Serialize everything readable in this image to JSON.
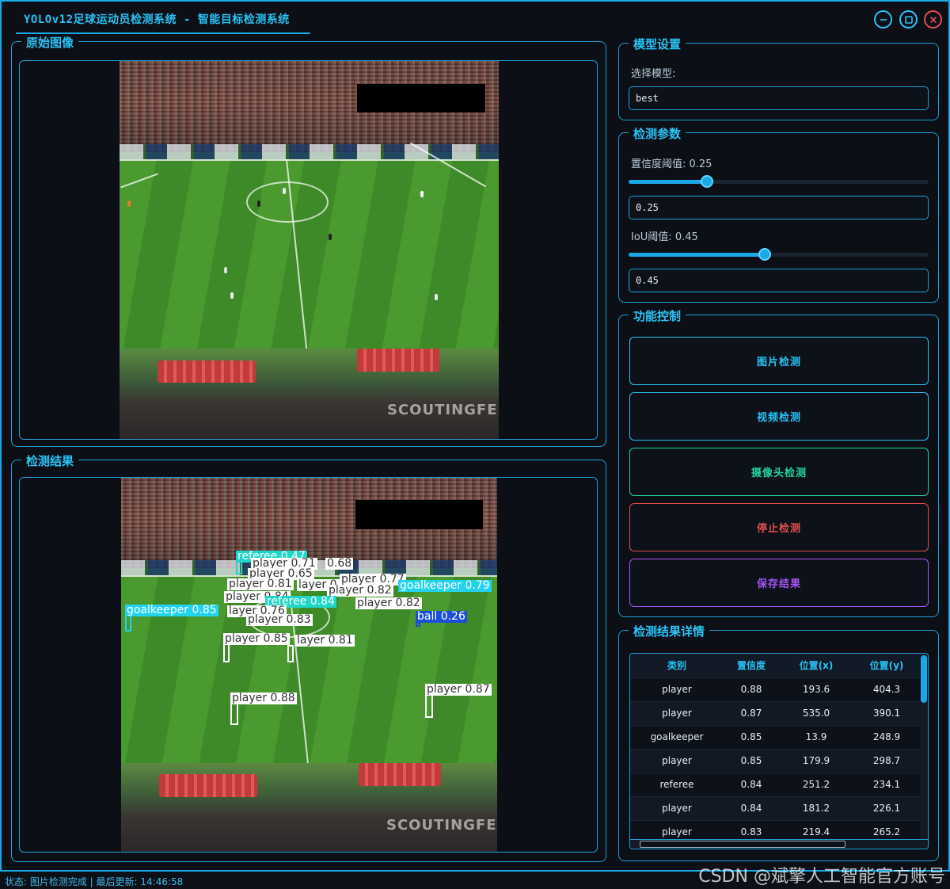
{
  "window": {
    "title": "YOLOv12足球运动员检测系统 - 智能目标检测系统"
  },
  "panels": {
    "original_title": "原始图像",
    "result_title": "检测结果",
    "model_title": "模型设置",
    "params_title": "检测参数",
    "control_title": "功能控制",
    "details_title": "检测结果详情"
  },
  "model": {
    "select_label": "选择模型:",
    "selected": "best"
  },
  "params": {
    "conf_label": "置信度阈值: 0.25",
    "conf_value": "0.25",
    "conf_level": 0.25,
    "iou_label": "IoU阈值: 0.45",
    "iou_value": "0.45",
    "iou_level": 0.45
  },
  "buttons": {
    "image_detect": "图片检测",
    "video_detect": "视频检测",
    "camera_detect": "摄像头检测",
    "stop_detect": "停止检测",
    "save_result": "保存结果"
  },
  "image": {
    "watermark": "SCOUTINGFEED"
  },
  "detections_overlay": [
    {
      "text": "referee 0.47",
      "color": "#1fd6c8"
    },
    {
      "text": "player 0.71",
      "color": "#ffffff"
    },
    {
      "text": "0.68",
      "color": "#ffffff"
    },
    {
      "text": "player 0.65",
      "color": "#ffffff"
    },
    {
      "text": "player 0.77",
      "color": "#ffffff"
    },
    {
      "text": "player 0.81",
      "color": "#ffffff"
    },
    {
      "text": "layer 0.",
      "color": "#ffffff"
    },
    {
      "text": "player 0.82",
      "color": "#ffffff"
    },
    {
      "text": "goalkeeper 0.79",
      "color": "#22d3ee"
    },
    {
      "text": "player 0.84",
      "color": "#ffffff"
    },
    {
      "text": "referee 0.84",
      "color": "#1fd6c8"
    },
    {
      "text": "player 0.82",
      "color": "#ffffff"
    },
    {
      "text": "goalkeeper 0.85",
      "color": "#22d3ee"
    },
    {
      "text": "layer 0.76",
      "color": "#ffffff"
    },
    {
      "text": "player 0.83",
      "color": "#ffffff"
    },
    {
      "text": "ball 0.26",
      "color": "#1d4ed8"
    },
    {
      "text": "player 0.85",
      "color": "#ffffff"
    },
    {
      "text": "layer 0.81",
      "color": "#ffffff"
    },
    {
      "text": "player 0.88",
      "color": "#ffffff"
    },
    {
      "text": "player 0.87",
      "color": "#ffffff"
    }
  ],
  "table": {
    "headers": [
      "类别",
      "置信度",
      "位置(x)",
      "位置(y)"
    ],
    "rows": [
      [
        "player",
        "0.88",
        "193.6",
        "404.3"
      ],
      [
        "player",
        "0.87",
        "535.0",
        "390.1"
      ],
      [
        "goalkeeper",
        "0.85",
        "13.9",
        "248.9"
      ],
      [
        "player",
        "0.85",
        "179.9",
        "298.7"
      ],
      [
        "referee",
        "0.84",
        "251.2",
        "234.1"
      ],
      [
        "player",
        "0.84",
        "181.2",
        "226.1"
      ],
      [
        "player",
        "0.83",
        "219.4",
        "265.2"
      ]
    ]
  },
  "status": {
    "text": "状态: 图片检测完成 | 最后更新: 14:46:58"
  },
  "watermark_csdn": "CSDN @斌擎人工智能官方账号",
  "colors": {
    "accent": "#1aa9e6",
    "title": "#29c3f5",
    "image_btn": "#29c3f5",
    "video_btn": "#29c3f5",
    "camera_btn": "#22d3a0",
    "stop_btn": "#e04e4e",
    "save_btn": "#a855f7"
  }
}
